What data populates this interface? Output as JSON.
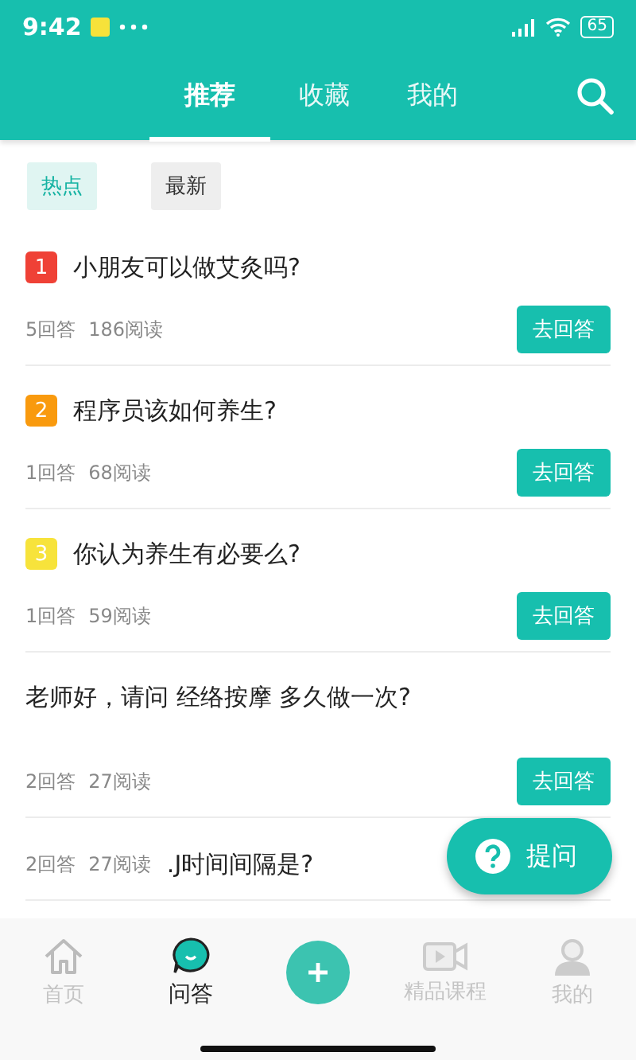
{
  "status_bar": {
    "time": "9:42",
    "battery": "65"
  },
  "tabs": [
    {
      "label": "推荐",
      "selected": true
    },
    {
      "label": "收藏",
      "selected": false
    },
    {
      "label": "我的",
      "selected": false
    }
  ],
  "filters": [
    {
      "label": "热点",
      "selected": true
    },
    {
      "label": "最新",
      "selected": false
    }
  ],
  "questions": [
    {
      "rank": "1",
      "color": "#ef4136",
      "title": "小朋友可以做艾灸吗?",
      "answers": "5回答",
      "reads": "186阅读",
      "button": "去回答"
    },
    {
      "rank": "2",
      "color": "#f99a0e",
      "title": "程序员该如何养生?",
      "answers": "1回答",
      "reads": "68阅读",
      "button": "去回答"
    },
    {
      "rank": "3",
      "color": "#f7e33b",
      "title": "你认为养生有必要么?",
      "answers": "1回答",
      "reads": "59阅读",
      "button": "去回答"
    },
    {
      "title": "老师好，请问 经络按摩 多久做一次?",
      "answers": "2回答",
      "reads": "27阅读",
      "button": "去回答"
    },
    {
      "title": ".J时间间隔是?",
      "answers": "2回答",
      "reads": "27阅读",
      "kind": "overlap"
    }
  ],
  "fab": {
    "label": "提问"
  },
  "bottom_nav": [
    {
      "kind": "home",
      "label": "首页",
      "selected": false
    },
    {
      "kind": "chat",
      "label": "问答",
      "selected": true
    },
    {
      "kind": "add"
    },
    {
      "kind": "video",
      "label": "精品课程",
      "selected": false
    },
    {
      "kind": "person",
      "label": "我的",
      "selected": false
    }
  ]
}
